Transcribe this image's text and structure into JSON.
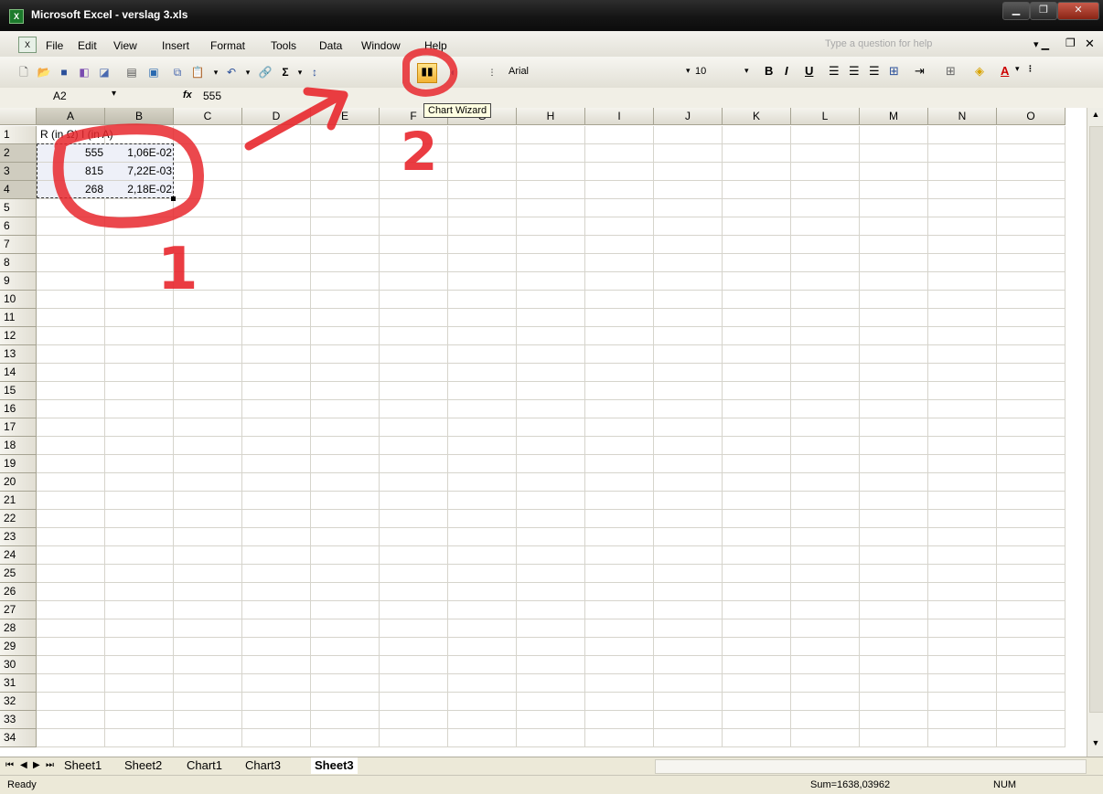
{
  "window": {
    "title": "Microsoft Excel - verslag 3.xls",
    "app_icon": "excel-icon",
    "controls": [
      "minimize",
      "restore",
      "close"
    ]
  },
  "menu": {
    "items": [
      "File",
      "Edit",
      "View",
      "Insert",
      "Format",
      "Tools",
      "Data",
      "Window",
      "Help"
    ],
    "help_placeholder": "Type a question for help"
  },
  "toolbar": {
    "font_name": "Arial",
    "font_size": "10",
    "bold": "B",
    "italic": "I",
    "underline": "U",
    "sigma": "Σ",
    "font_color": "A",
    "tooltip": "Chart Wizard"
  },
  "formula_bar": {
    "name_box": "A2",
    "fx": "fx",
    "formula": "555"
  },
  "grid": {
    "columns": [
      "A",
      "B",
      "C",
      "D",
      "E",
      "F",
      "G",
      "H",
      "I",
      "J",
      "K",
      "L",
      "M",
      "N",
      "O"
    ],
    "rows": [
      "1",
      "2",
      "3",
      "4",
      "5",
      "6",
      "7",
      "8",
      "9",
      "10",
      "11",
      "12",
      "13",
      "14",
      "15",
      "16",
      "17",
      "18",
      "19",
      "20",
      "21",
      "22",
      "23",
      "24",
      "25",
      "26",
      "27",
      "28",
      "29",
      "30",
      "31",
      "32",
      "33",
      "34"
    ],
    "header_text": "R (in Ω) I (in A)",
    "data": [
      {
        "a": "555",
        "b": "1,06E-02"
      },
      {
        "a": "815",
        "b": "7,22E-03"
      },
      {
        "a": "268",
        "b": "2,18E-02"
      }
    ]
  },
  "sheets": {
    "tabs": [
      "Sheet1",
      "Sheet2",
      "Chart1",
      "Chart3",
      "Sheet3"
    ],
    "active": "Sheet3"
  },
  "status": {
    "state": "Ready",
    "sum": "Sum=1638,03962",
    "num": "NUM"
  },
  "annotations": {
    "step1": "1",
    "step2": "2",
    "color": "#e8282e"
  }
}
